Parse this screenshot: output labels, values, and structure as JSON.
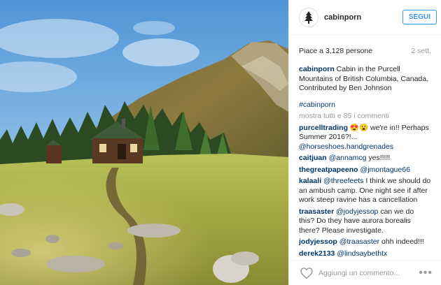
{
  "post": {
    "username": "cabinporn",
    "follow_label": "SEGUI",
    "likes": "Piace a 3,128 persone",
    "time": "2 sett."
  },
  "caption": {
    "user": "cabinporn",
    "text": " Cabin in the Purcell Mountains of British Columbia, Canada. Contributed by Ben Johnson",
    "hashtag": "#cabinporn"
  },
  "show_all": "mostra tutti e 85 i commenti",
  "comments": [
    {
      "user": "purcelltrading",
      "pre": " 😍😮 we're in!! Perhaps Summer 2016?!... ",
      "mention": "@horseshoes.handgrenades",
      "post": ""
    },
    {
      "user": "caitjuan",
      "pre": " ",
      "mention": "@annamcg",
      "post": " yes!!!!!"
    },
    {
      "user": "thegreatpapeeno",
      "pre": " ",
      "mention": "@jmontague66",
      "post": ""
    },
    {
      "user": "kalaali",
      "pre": " ",
      "mention": "@threefeets",
      "post": " I think we should do an ambush camp. One night see if after work steep ravine has a cancellation"
    },
    {
      "user": "traasaster",
      "pre": " ",
      "mention": "@jodyjessop",
      "post": " can we do this? Do they have aurora borealis there? Please investigate."
    },
    {
      "user": "jodyjessop",
      "pre": " ",
      "mention": "@traasaster",
      "post": " ohh indeed!!!"
    },
    {
      "user": "derek2133",
      "pre": " ",
      "mention": "@lindsaybethtx",
      "post": ""
    }
  ],
  "footer": {
    "add_comment_placeholder": "Aggiungi un commento...",
    "more": "•••"
  },
  "icons": {
    "avatar": "tree-icon",
    "like": "heart-icon",
    "options": "more-options-icon"
  },
  "colors": {
    "follow_blue": "#3897f0",
    "link_blue": "#003569",
    "muted": "#999999"
  }
}
